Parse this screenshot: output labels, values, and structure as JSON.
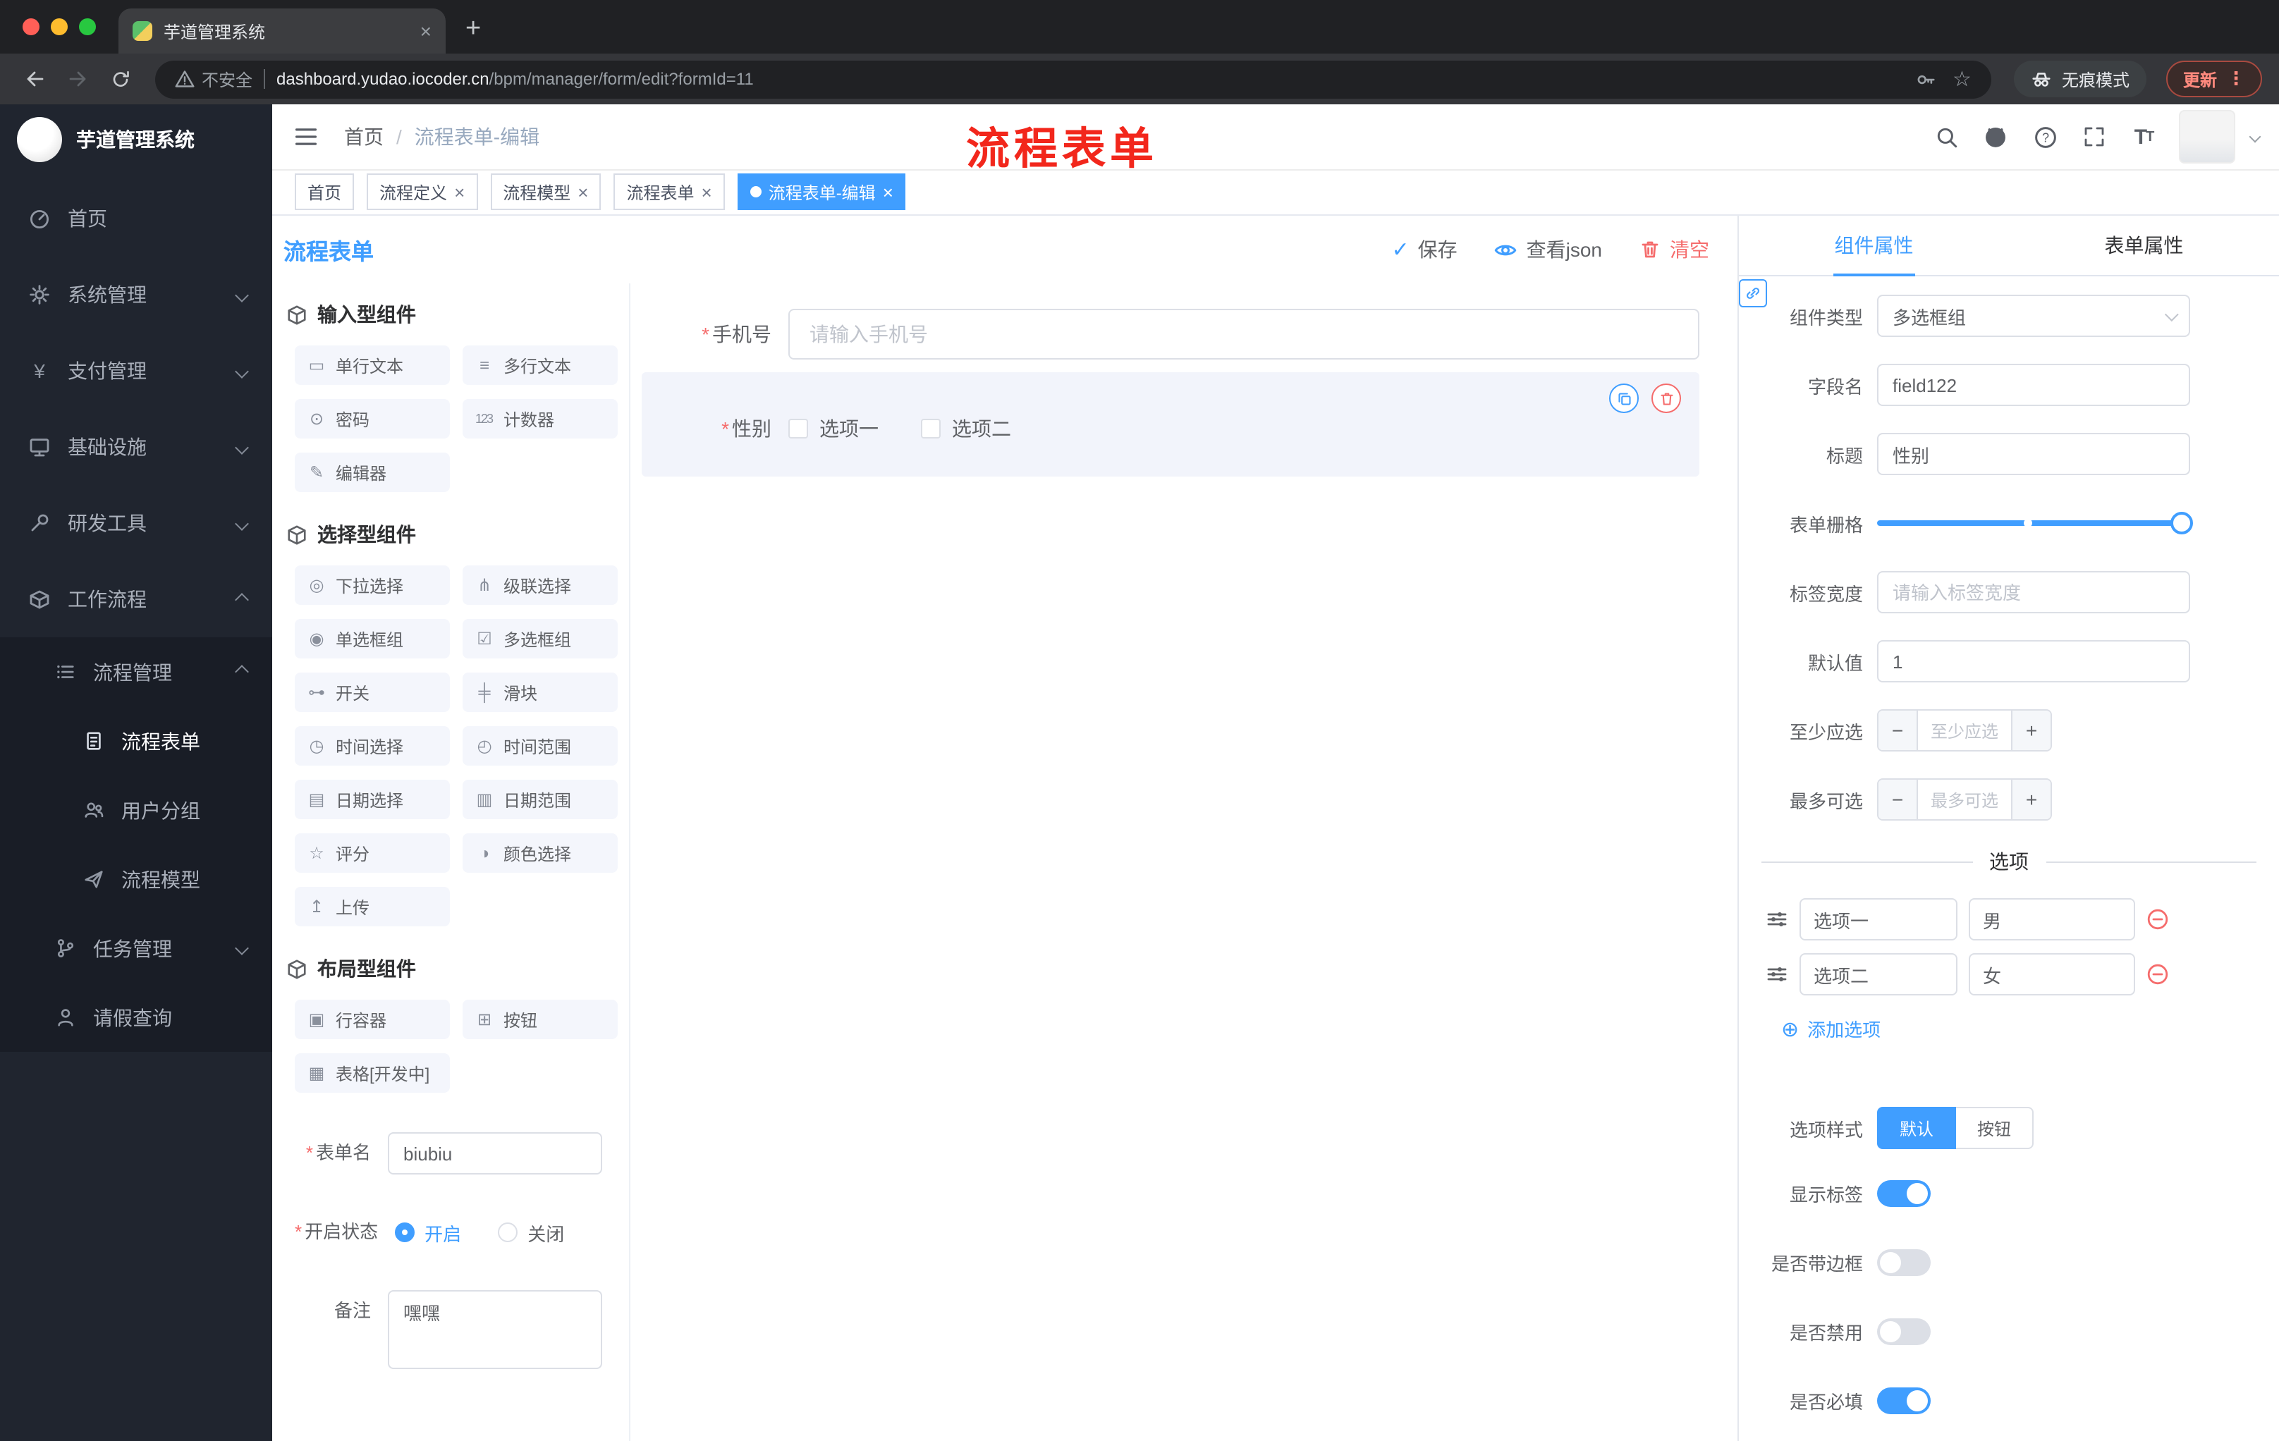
{
  "browser": {
    "tab_title": "芋道管理系统",
    "security_label": "不安全",
    "url_host": "dashboard.yudao.iocoder.cn",
    "url_path": "/bpm/manager/form/edit?formId=11",
    "incognito_label": "无痕模式",
    "update_label": "更新"
  },
  "sidebar": {
    "logo_title": "芋道管理系统",
    "items": [
      {
        "label": "首页"
      },
      {
        "label": "系统管理"
      },
      {
        "label": "支付管理"
      },
      {
        "label": "基础设施"
      },
      {
        "label": "研发工具"
      },
      {
        "label": "工作流程"
      },
      {
        "label": "流程管理"
      },
      {
        "label": "流程表单"
      },
      {
        "label": "用户分组"
      },
      {
        "label": "流程模型"
      },
      {
        "label": "任务管理"
      },
      {
        "label": "请假查询"
      }
    ]
  },
  "header": {
    "breadcrumb": {
      "home": "首页",
      "current": "流程表单-编辑"
    },
    "annotation": "流程表单"
  },
  "tags": [
    {
      "label": "首页"
    },
    {
      "label": "流程定义"
    },
    {
      "label": "流程模型"
    },
    {
      "label": "流程表单"
    },
    {
      "label": "流程表单-编辑"
    }
  ],
  "designer": {
    "title": "流程表单",
    "actions": {
      "save": "保存",
      "view_json": "查看json",
      "clear": "清空"
    },
    "palette": {
      "groups": [
        {
          "title": "输入型组件",
          "items": [
            {
              "icon": "▭",
              "label": "单行文本"
            },
            {
              "icon": "≡",
              "label": "多行文本"
            },
            {
              "icon": "⊙",
              "label": "密码"
            },
            {
              "icon": "123",
              "label": "计数器"
            },
            {
              "icon": "✎",
              "label": "编辑器"
            }
          ]
        },
        {
          "title": "选择型组件",
          "items": [
            {
              "icon": "◎",
              "label": "下拉选择"
            },
            {
              "icon": "⋔",
              "label": "级联选择"
            },
            {
              "icon": "◉",
              "label": "单选框组"
            },
            {
              "icon": "☑",
              "label": "多选框组"
            },
            {
              "icon": "⊶",
              "label": "开关"
            },
            {
              "icon": "╪",
              "label": "滑块"
            },
            {
              "icon": "◷",
              "label": "时间选择"
            },
            {
              "icon": "◴",
              "label": "时间范围"
            },
            {
              "icon": "▤",
              "label": "日期选择"
            },
            {
              "icon": "▥",
              "label": "日期范围"
            },
            {
              "icon": "☆",
              "label": "评分"
            },
            {
              "icon": "◑",
              "label": "颜色选择"
            },
            {
              "icon": "↥",
              "label": "上传"
            }
          ]
        },
        {
          "title": "布局型组件",
          "items": [
            {
              "icon": "▣",
              "label": "行容器"
            },
            {
              "icon": "⊞",
              "label": "按钮"
            },
            {
              "icon": "▦",
              "label": "表格[开发中]"
            }
          ]
        }
      ]
    },
    "meta": {
      "name_label": "表单名",
      "name_value": "biubiu",
      "status_label": "开启状态",
      "status_on": "开启",
      "status_off": "关闭",
      "remark_label": "备注",
      "remark_value": "嘿嘿"
    },
    "canvas": {
      "phone": {
        "label": "手机号",
        "placeholder": "请输入手机号"
      },
      "gender": {
        "label": "性别",
        "options": [
          {
            "label": "选项一"
          },
          {
            "label": "选项二"
          }
        ]
      }
    }
  },
  "props": {
    "tabs": {
      "component": "组件属性",
      "form": "表单属性"
    },
    "component_type": {
      "label": "组件类型",
      "value": "多选框组"
    },
    "field_name": {
      "label": "字段名",
      "value": "field122"
    },
    "title": {
      "label": "标题",
      "value": "性别"
    },
    "grid": {
      "label": "表单栅格"
    },
    "label_width": {
      "label": "标签宽度",
      "placeholder": "请输入标签宽度"
    },
    "default_value": {
      "label": "默认值",
      "value": "1"
    },
    "min_select": {
      "label": "至少应选",
      "placeholder": "至少应选"
    },
    "max_select": {
      "label": "最多可选",
      "placeholder": "最多可选"
    },
    "stepper": {
      "minus": "−",
      "plus": "+"
    },
    "options": {
      "divider": "选项",
      "rows": [
        {
          "label": "选项一",
          "value": "男"
        },
        {
          "label": "选项二",
          "value": "女"
        }
      ],
      "add_icon": "⊕",
      "add_label": "添加选项"
    },
    "option_style": {
      "label": "选项样式",
      "default": "默认",
      "button": "按钮"
    },
    "toggles": [
      {
        "label": "显示标签",
        "on": true
      },
      {
        "label": "是否带边框",
        "on": false
      },
      {
        "label": "是否禁用",
        "on": false
      },
      {
        "label": "是否必填",
        "on": true
      }
    ]
  },
  "colors": {
    "accent": "#409eff",
    "danger": "#f56c6c",
    "annotation": "#f2271c"
  }
}
